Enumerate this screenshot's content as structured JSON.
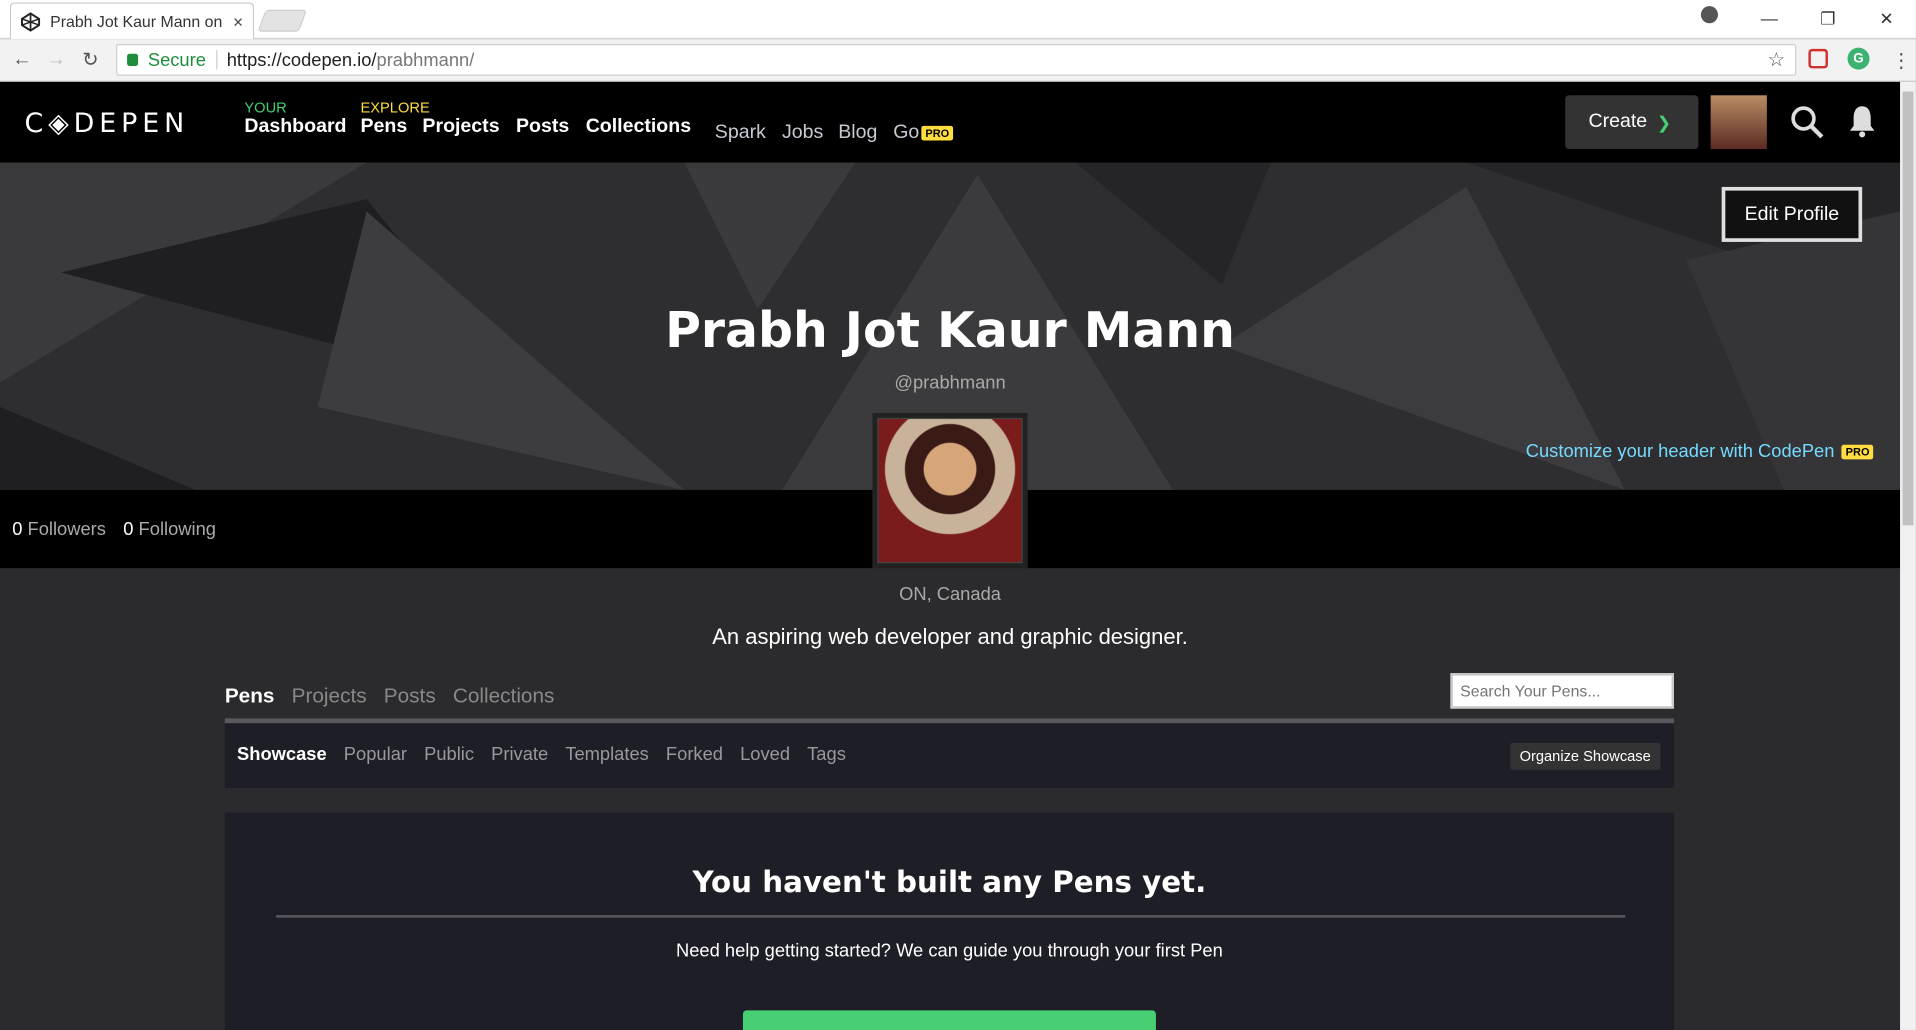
{
  "browser": {
    "tab_title": "Prabh Jot Kaur Mann on",
    "tab_close": "×",
    "secure_label": "Secure",
    "url_host": "https://codepen.io/",
    "url_path": "prabhmann/",
    "win_min": "—",
    "win_max": "❐",
    "win_close": "✕"
  },
  "header": {
    "logo": "C◈DEPEN",
    "your_label": "YOUR",
    "dashboard": "Dashboard",
    "explore_label": "EXPLORE",
    "pens": "Pens",
    "projects": "Projects",
    "posts": "Posts",
    "collections": "Collections",
    "spark": "Spark",
    "jobs": "Jobs",
    "blog": "Blog",
    "go": "Go",
    "pro_badge": "PRO",
    "create": "Create"
  },
  "profile": {
    "edit_profile": "Edit Profile",
    "name": "Prabh Jot Kaur Mann",
    "handle": "@prabhmann",
    "customize": "Customize your header with CodePen",
    "followers_count": "0",
    "followers_label": "Followers",
    "following_count": "0",
    "following_label": "Following",
    "location": "ON, Canada",
    "bio": "An aspiring web developer and graphic designer."
  },
  "content_tabs": [
    "Pens",
    "Projects",
    "Posts",
    "Collections"
  ],
  "search_placeholder": "Search Your Pens...",
  "sub_tabs": [
    "Showcase",
    "Popular",
    "Public",
    "Private",
    "Templates",
    "Forked",
    "Loved",
    "Tags"
  ],
  "organize_showcase": "Organize Showcase",
  "empty": {
    "title": "You haven't built any Pens yet.",
    "subtitle": "Need help getting started? We can guide you through your first Pen"
  }
}
